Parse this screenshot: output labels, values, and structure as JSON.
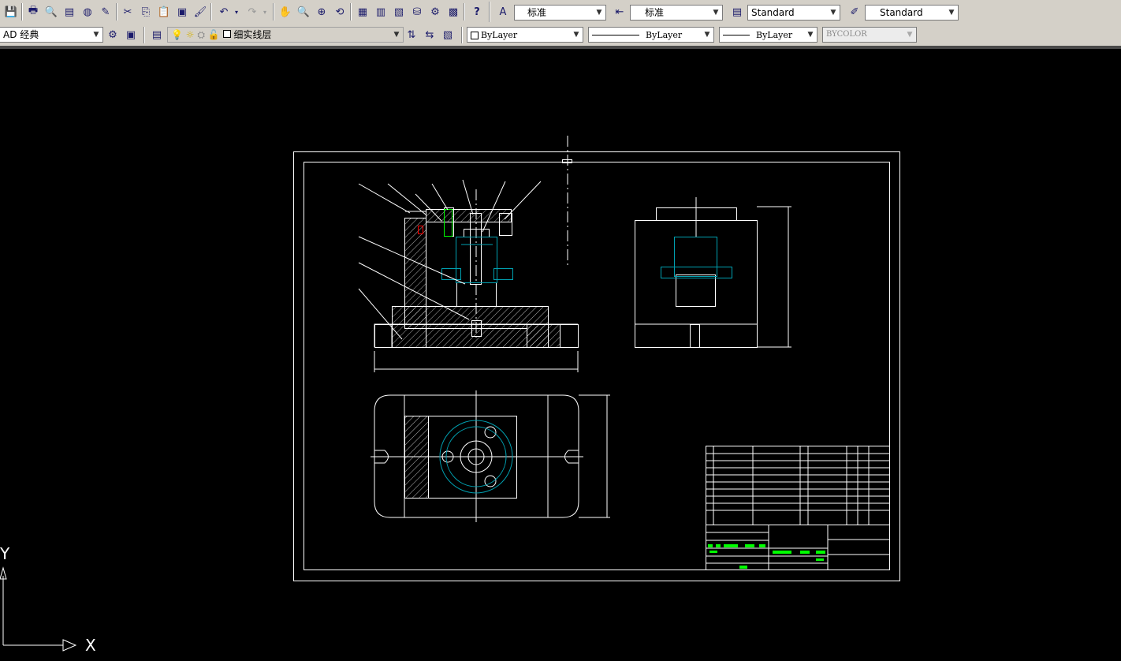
{
  "toolbar1": {
    "text_style": "标准",
    "dim_style": "标准",
    "table_style": "Standard",
    "mleader_style": "Standard"
  },
  "toolbar2": {
    "workspace": "AD 经典",
    "layer": "细实线层",
    "color": "ByLayer",
    "linetype": "ByLayer",
    "lineweight": "ByLayer",
    "plotstyle": "BYCOLOR"
  },
  "ucs": {
    "x_label": "X",
    "y_label": "Y"
  },
  "colors": {
    "background": "#000000",
    "drawing_line": "#ffffff",
    "hatch_hidden": "#00a0b0",
    "highlight": "#00ff00",
    "red": "#ff0000"
  }
}
